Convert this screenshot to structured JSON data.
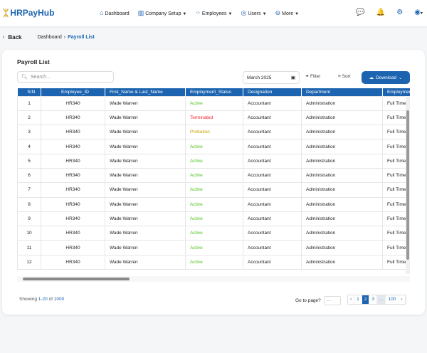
{
  "nav": {
    "brand": "HRPayHub",
    "items": [
      {
        "label": "Dashboard",
        "icon": "home-icon",
        "caret": false
      },
      {
        "label": "Company Setup",
        "icon": "building-icon",
        "caret": true
      },
      {
        "label": "Employees",
        "icon": "people-icon",
        "caret": true
      },
      {
        "label": "Users",
        "icon": "user-circle-icon",
        "caret": true
      },
      {
        "label": "More",
        "icon": "more-icon",
        "caret": true
      }
    ]
  },
  "breadcrumb": {
    "back": "Back",
    "root": "Dashboard",
    "current": "Payroll List"
  },
  "page": {
    "title": "Payroll List",
    "search_placeholder": "Search...",
    "date": "March 2025",
    "filter": "Filter",
    "sort": "Sort",
    "download": "Download"
  },
  "table": {
    "headers": [
      "S/N",
      "Employee_ID",
      "First_Name & Last_Name",
      "Employment_Status",
      "Designation",
      "Department",
      "Employment"
    ],
    "rows": [
      [
        "1",
        "HR340",
        "Wade Warren",
        "Active",
        "Accountant",
        "Administration",
        "Full Time"
      ],
      [
        "2",
        "HR340",
        "Wade Warren",
        "Terminated",
        "Accountant",
        "Administration",
        "Full Time"
      ],
      [
        "3",
        "HR340",
        "Wade Warren",
        "Probation",
        "Accountant",
        "Administration",
        "Full Time"
      ],
      [
        "4",
        "HR340",
        "Wade Warren",
        "Active",
        "Accountant",
        "Administration",
        "Full Time"
      ],
      [
        "5",
        "HR340",
        "Wade Warren",
        "Active",
        "Accountant",
        "Administration",
        "Full Time"
      ],
      [
        "6",
        "HR340",
        "Wade Warren",
        "Active",
        "Accountant",
        "Administration",
        "Full Time"
      ],
      [
        "7",
        "HR340",
        "Wade Warren",
        "Active",
        "Accountant",
        "Administration",
        "Full Time"
      ],
      [
        "8",
        "HR340",
        "Wade Warren",
        "Active",
        "Accountant",
        "Administration",
        "Full Time"
      ],
      [
        "9",
        "HR340",
        "Wade Warren",
        "Active",
        "Accountant",
        "Administration",
        "Full Time"
      ],
      [
        "10",
        "HR340",
        "Wade Warren",
        "Active",
        "Accountant",
        "Administration",
        "Full Time"
      ],
      [
        "11",
        "HR340",
        "Wade Warren",
        "Active",
        "Accountant",
        "Administration",
        "Full Time"
      ],
      [
        "12",
        "HR340",
        "Wade Warren",
        "Active",
        "Accountant",
        "Administration",
        "Full Time"
      ]
    ]
  },
  "status_colors": {
    "Active": "#52c41a",
    "Terminated": "#f5222d",
    "Probation": "#c8a200"
  },
  "footer": {
    "showing_prefix": "Showing ",
    "range": "1-20",
    "of": " of ",
    "total": "1000",
    "goto": "Go to page?",
    "goto_placeholder": "—",
    "pages": [
      "‹",
      "1",
      "2",
      "3",
      "...",
      "100",
      "›"
    ],
    "active_page": "2"
  }
}
